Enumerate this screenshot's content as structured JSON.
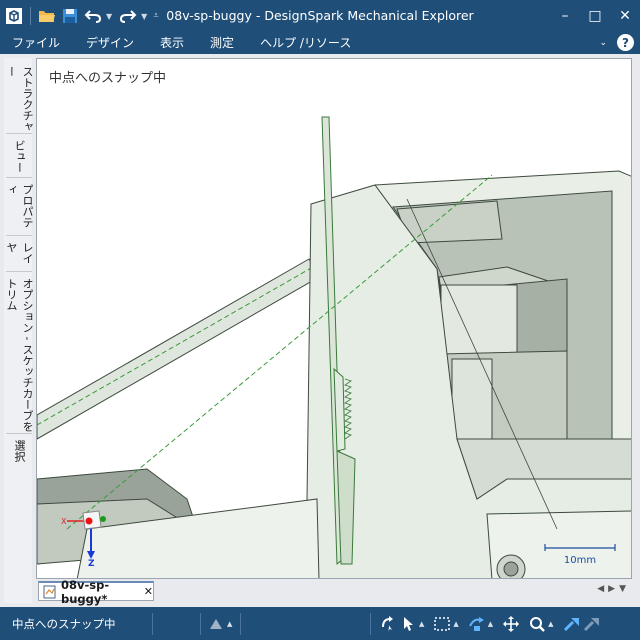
{
  "window": {
    "title": "08v-sp-buggy - DesignSpark Mechanical Explorer",
    "controls": {
      "minimize": "–",
      "maximize": "□",
      "close": "✕"
    }
  },
  "quick_access": {
    "icons": [
      "app-logo-icon",
      "open-folder-icon",
      "save-icon",
      "undo-icon",
      "redo-icon",
      "customize-icon"
    ],
    "colors": {
      "folder": "#f2b84b",
      "save": "#3b8fd9"
    }
  },
  "menu": {
    "items": [
      "ファイル",
      "デザイン",
      "表示",
      "測定",
      "ヘルプ /リソース"
    ],
    "help_symbol": "?"
  },
  "side_panels": {
    "tabs": [
      "ストラクチャー",
      "ビュー",
      "プロパティ",
      "レイヤ",
      "オプション - スケッチカーブをトリム",
      "選択"
    ]
  },
  "viewport": {
    "status_text": "中点へのスナップ中",
    "scale_label": "10mm",
    "triad": {
      "x_label": "X",
      "z_label": "Z"
    },
    "colors": {
      "edge": "#3d4a3d",
      "face_light": "#e9efe7",
      "face_mid": "#cdd5cb",
      "face_dark": "#9aa39a",
      "highlight": "#3a9a3a",
      "axis_x": "#d22",
      "axis_y": "#1a9a1a",
      "axis_z": "#1a3ad6"
    }
  },
  "document_tabs": {
    "active": "08v-sp-buggy*",
    "close_symbol": "✕",
    "nav_prev": "◀",
    "nav_next": "▶",
    "nav_menu": "▼"
  },
  "status_bar": {
    "message": "中点へのスナップ中",
    "tools": [
      "triangle-icon",
      "rotate-view-icon",
      "select-arrow-icon",
      "box-select-icon",
      "move-icon",
      "pan-icon",
      "zoom-icon",
      "pull-icon",
      "sketch-icon"
    ]
  }
}
